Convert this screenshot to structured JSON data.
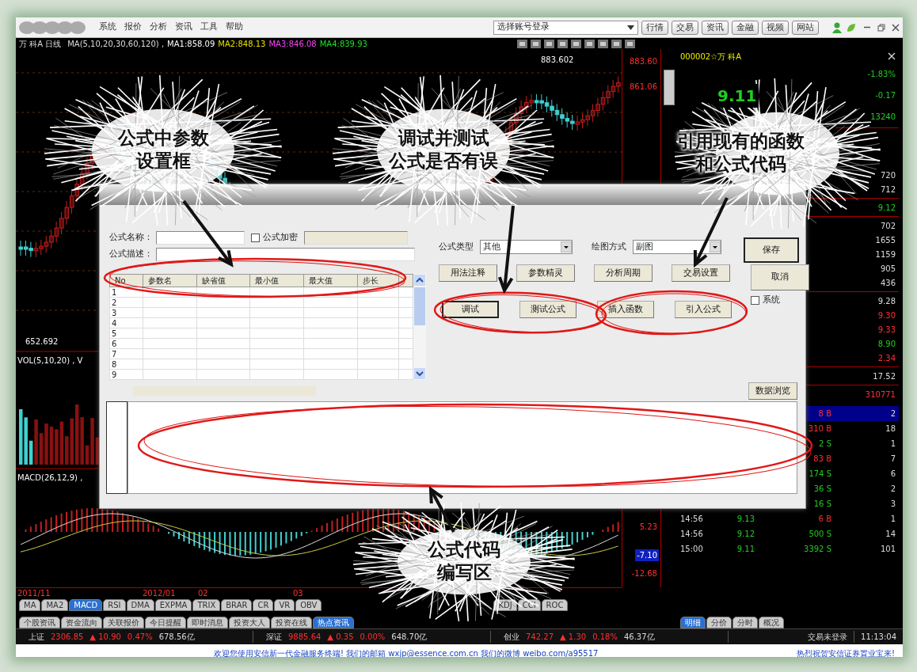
{
  "menu_bar": {
    "menus": [
      "系统",
      "报价",
      "分析",
      "资讯",
      "工具",
      "帮助"
    ],
    "account_select": "选择账号登录",
    "buttons": [
      "行情",
      "交易",
      "资讯",
      "金融",
      "视频",
      "网站"
    ]
  },
  "chart": {
    "title": "万 科A 日线",
    "ma_params": "MA(5,10,20,30,60,120) ,",
    "ma_values": [
      {
        "text": "MA1:858.09",
        "color": "#ffffff"
      },
      {
        "text": "MA2:848.13",
        "color": "#e8e000"
      },
      {
        "text": "MA3:846.08",
        "color": "#ff40ff"
      },
      {
        "text": "MA4:839.93",
        "color": "#20e020"
      }
    ],
    "high_label": "883.602",
    "low_label": "652.692",
    "volume_title": "VOL(5,10,20) , V",
    "macd_title": "MACD(26,12,9) ,",
    "axis_labels": [
      {
        "text": "883.60",
        "selected": false
      },
      {
        "text": "861.06",
        "selected": false
      },
      {
        "text": "5.23",
        "selected": false
      },
      {
        "text": "-7.10",
        "selected": true
      },
      {
        "text": "-12.68",
        "selected": false
      }
    ],
    "dates": [
      "2011/11",
      "2012/01",
      "02",
      "03"
    ]
  },
  "indicator_tabs": [
    {
      "label": "MA",
      "selected": false
    },
    {
      "label": "MA2",
      "selected": false
    },
    {
      "label": "MACD",
      "selected": true
    },
    {
      "label": "RSI",
      "selected": false
    },
    {
      "label": "DMA",
      "selected": false
    },
    {
      "label": "EXPMA",
      "selected": false
    },
    {
      "label": "TRIX",
      "selected": false
    },
    {
      "label": "BRAR",
      "selected": false
    },
    {
      "label": "CR",
      "selected": false
    },
    {
      "label": "VR",
      "selected": false
    },
    {
      "label": "OBV",
      "selected": false
    },
    {
      "label": "KDJ",
      "selected": false
    },
    {
      "label": "CCI",
      "selected": false
    },
    {
      "label": "ROC",
      "selected": false
    }
  ],
  "info_tabs": [
    {
      "label": "个股资讯",
      "selected": false
    },
    {
      "label": "资金流向",
      "selected": false
    },
    {
      "label": "关联报价",
      "selected": false
    },
    {
      "label": "今日提醒",
      "selected": false
    },
    {
      "label": "即时消息",
      "selected": false
    },
    {
      "label": "投资大人",
      "selected": false
    },
    {
      "label": "投资在线",
      "selected": false
    },
    {
      "label": "热点资讯",
      "selected": true
    }
  ],
  "quote_panel": {
    "code": "000002☆万 科A",
    "price": "9.11",
    "stats": [
      {
        "text": "-1.83%",
        "color": "#22cc22"
      },
      {
        "text": "-0.17",
        "color": "#22cc22"
      },
      {
        "text": "13240",
        "color": "#22cc22"
      },
      {
        "text": "720",
        "color": "#dddddd"
      },
      {
        "text": "712",
        "color": "#dddddd"
      },
      {
        "text": "9.12",
        "color": "#22cc22"
      },
      {
        "text": "702",
        "color": "#dddddd"
      },
      {
        "text": "1655",
        "color": "#dddddd"
      },
      {
        "text": "1159",
        "color": "#dddddd"
      },
      {
        "text": "905",
        "color": "#dddddd"
      },
      {
        "text": "436",
        "color": "#dddddd"
      },
      {
        "text": "9.28",
        "color": "#dddddd"
      },
      {
        "text": "9.30",
        "color": "#ff3030"
      },
      {
        "text": "9.33",
        "color": "#ff3030"
      },
      {
        "text": "8.90",
        "color": "#22cc22"
      },
      {
        "text": "2.34",
        "color": "#ff3030"
      },
      {
        "text": "17.52",
        "color": "#dddddd"
      },
      {
        "text": "310771",
        "color": "#ff3030"
      }
    ],
    "ticks": [
      {
        "volume": "8 B",
        "count": "2",
        "selected": true
      },
      {
        "volume": "310 B",
        "count": "18",
        "selected": false
      },
      {
        "volume": "2 S",
        "count": "1",
        "selected": false
      },
      {
        "volume": "83 B",
        "count": "7",
        "selected": false
      },
      {
        "volume": "174 S",
        "count": "6",
        "selected": false
      },
      {
        "volume": "36 S",
        "count": "2",
        "selected": false
      },
      {
        "volume": "16 S",
        "count": "3",
        "selected": false
      },
      {
        "time": "14:56",
        "price": "9.13",
        "volume": "6 B",
        "count": "1",
        "selected": false
      },
      {
        "time": "14:56",
        "price": "9.12",
        "volume": "500 S",
        "count": "14",
        "selected": false
      },
      {
        "time": "15:00",
        "price": "9.11",
        "volume": "3392 S",
        "count": "101",
        "selected": false
      }
    ],
    "tabs": [
      {
        "label": "明细",
        "selected": true
      },
      {
        "label": "分价",
        "selected": false
      },
      {
        "label": "分时",
        "selected": false
      },
      {
        "label": "概况",
        "selected": false
      }
    ]
  },
  "status_bar": {
    "indices": [
      {
        "name": "上证",
        "value": "2306.85",
        "change": "▲ 10.90",
        "percent": "0.47%",
        "amount": "678.56亿"
      },
      {
        "name": "深证",
        "value": "9885.64",
        "change": "▲ 0.35",
        "percent": "0.00%",
        "amount": "648.70亿"
      },
      {
        "name": "创业",
        "value": "742.27",
        "change": "▲ 1.30",
        "percent": "0.18%",
        "amount": "46.37亿"
      }
    ],
    "login": "交易未登录",
    "time": "11:13:04"
  },
  "footer": {
    "message": "欢迎您使用安信新一代金融服务终端! 我们的邮箱 wxjp@essence.com.cn 我们的微博 weibo.com/a95517",
    "notice": "热烈祝贺安信证券置业宝来!"
  },
  "dialog": {
    "name_label": "公式名称：",
    "encrypt": {
      "label": "公式加密",
      "checked": false
    },
    "desc_label": "公式描述：",
    "params_table": {
      "columns": [
        "No",
        "参数名",
        "缺省值",
        "最小值",
        "最大值",
        "步长"
      ],
      "rows": [
        "1",
        "2",
        "3",
        "4",
        "5",
        "6",
        "7",
        "8",
        "9"
      ]
    },
    "type_label": "公式类型",
    "type_value": "其他",
    "draw_label": "绘图方式",
    "draw_value": "副图",
    "save": {
      "label": "保存",
      "default": true
    },
    "cancel": {
      "label": "取消",
      "default": false
    },
    "tool_buttons": [
      {
        "label": "用法注释",
        "default": false
      },
      {
        "label": "参数精灵",
        "default": false
      },
      {
        "label": "分析周期",
        "default": false
      },
      {
        "label": "交易设置",
        "default": false
      }
    ],
    "test_buttons": [
      {
        "label": "调试",
        "default": true
      },
      {
        "label": "测试公式",
        "default": false
      },
      {
        "label": "插入函数",
        "default": false
      },
      {
        "label": "引入公式",
        "default": false
      }
    ],
    "system": {
      "label": "系统",
      "checked": false
    },
    "data_browse": "数据浏览"
  },
  "annotations": [
    {
      "lines": [
        "公式中参数",
        "设置框"
      ]
    },
    {
      "lines": [
        "调试并测试",
        "公式是否有误"
      ]
    },
    {
      "lines": [
        "引用现有的函数",
        "和公式代码"
      ]
    },
    {
      "lines": [
        "公式代码",
        "编写区"
      ]
    }
  ]
}
